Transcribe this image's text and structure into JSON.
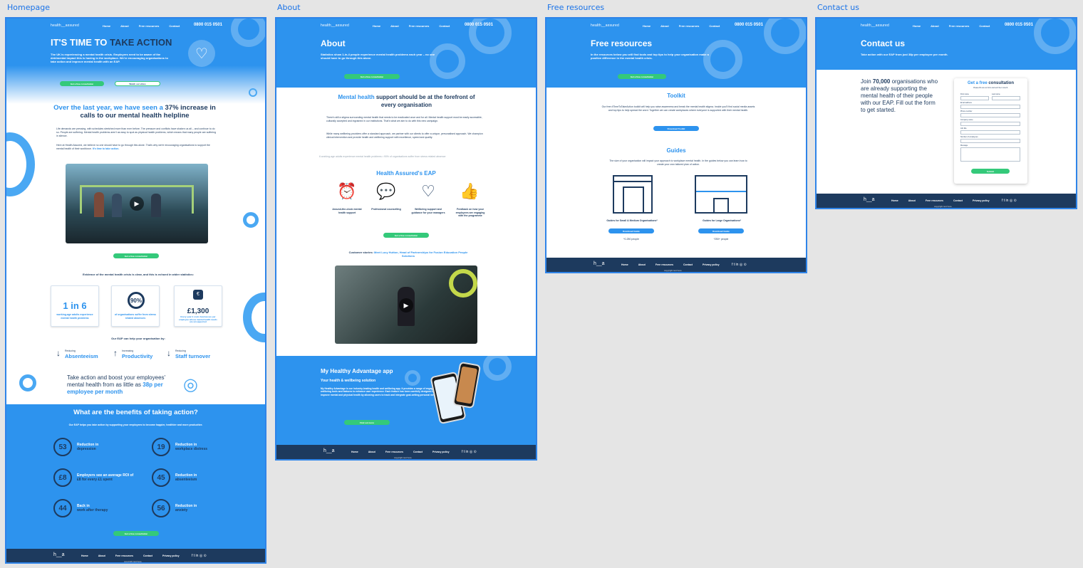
{
  "labels": {
    "homepage": "Homepage",
    "about": "About",
    "resources": "Free resources",
    "contact": "Contact us"
  },
  "nav": {
    "logo": "health__assured",
    "links": [
      "Home",
      "About",
      "Free resources",
      "Contact"
    ],
    "phone": "0800 015 0501"
  },
  "home": {
    "hero_title_a": "IT'S TIME TO ",
    "hero_title_b": "TAKE ACTION",
    "hero_text": "The UK is experiencing a mental health crisis. Employers need to be aware of the detrimental impact this is having in the workplace. We're encouraging organisations to take action and improve mental health with an EAP.",
    "btn_consult": "Get a free consultation",
    "btn_video": "Watch our video",
    "stat_heading_a": "Over the last year, we have seen a ",
    "stat_heading_b": "37% increase",
    "stat_heading_c": " in calls to our mental health helpline",
    "para1": "Life demands are pressing, with schedules stretched more than ever before. The pressure and conflicts have shaken us all – and continue to do so. People are suffering. Mental health problems aren't as easy to spot as physical health problems, which means that many people are suffering in silence.",
    "para2": "Here at Health Assured, we believe no one should have to go through this alone. That's why we're encouraging organisations to support the mental health of their workforce.",
    "para2_link": "It's time to take action.",
    "evidence": "Evidence of the mental health crisis is clear, and this is echoed in wider statistics:",
    "stats": [
      {
        "big": "1 in 6",
        "label": "working-age adults experience mental health problems"
      },
      {
        "big": "90%",
        "label": "of organisations suffer from stress related absences"
      },
      {
        "big": "£1,300",
        "label": "Every year it costs businesses per employee whose mental health needs are unsupported"
      }
    ],
    "eap_help": "Our EAP can help your organisation by:",
    "helps": [
      {
        "small": "Reducing",
        "big": "Absenteeism",
        "arrow": "↓"
      },
      {
        "small": "Increasing",
        "big": "Productivity",
        "arrow": "↑"
      },
      {
        "small": "Reducing",
        "big": "Staff turnover",
        "arrow": "↓"
      }
    ],
    "boost_a": "Take action and boost your employees' mental health from as little as ",
    "boost_b": "38p per employee per month",
    "benefits_title": "What are the benefits of taking action?",
    "benefits_sub": "Our EAP helps you take action by supporting your employees to become happier, healthier and more productive.",
    "benefits": [
      {
        "num": "53",
        "a": "Reduction in",
        "b": "depression"
      },
      {
        "num": "19",
        "a": "Reduction in",
        "b": "workplace distress"
      },
      {
        "num": "£8",
        "a": "Employers see an average ROI of",
        "b": "£8 for every £1 spent"
      },
      {
        "num": "45",
        "a": "Reduction in",
        "b": "absenteeism"
      },
      {
        "num": "44",
        "a": "Back in",
        "b": "work after therapy"
      },
      {
        "num": "56",
        "a": "Reduction in",
        "b": "anxiety"
      }
    ]
  },
  "about": {
    "title": "About",
    "intro": "Statistics show 1-in-4 people experience mental health problems each year – no one should have to go through this alone.",
    "btn": "Get a free consultation",
    "h2_a": "Mental health",
    "h2_b": " support should be at the forefront of every organisation",
    "p1": "There's still a stigma surrounding mental health that needs to be eradicated once and for all. Mental health support must be easily accessible, culturally accepted and ingrained in our institutions. That's what we aim to do with this new campaign.",
    "p2": "While many wellbeing providers offer a standard approach, we partner with our clients to offer a unique, personalised approach. We champion clinical intervention and provide health and wellbeing support with excellence, speed and quality.",
    "ticker": "6 working-age adults experience mental health problems • 90% of organisations suffer from stress related absence",
    "eap_title": "Health Assured's EAP",
    "eap_items": [
      {
        "icon": "⏰",
        "label": "Around-the-clock mental health support"
      },
      {
        "icon": "💬",
        "label": "Professional counselling"
      },
      {
        "icon": "♡",
        "label": "Wellbeing support and guidance for your managers"
      },
      {
        "icon": "👍",
        "label": "Feedback on how your employees are engaging with the programme"
      }
    ],
    "story_a": "Customer stories: ",
    "story_b": "Meet Lucy Hutton, Head of Partnerships for Fusion Education People Solutions",
    "app_title": "My Healthy Advantage app",
    "app_sub": "Your health & wellbeing solution",
    "app_text": "My Healthy Advantage is our industry-leading health and wellbeing app. It provides a range of engaging wellbeing tools and features to enhance user experience. Each feature has been carefully designed to improve mental and physical health by allowing users to track and integrate goal-setting personal metrics.",
    "app_btn": "Find out more"
  },
  "resources": {
    "title": "Free resources",
    "intro": "In the resources below you will find tools and top tips to help your organisation make a positive difference in the mental health crisis.",
    "btn": "Get a free consultation",
    "toolkit": "Toolkit",
    "toolkit_text": "Our free #TimeToTakeAction toolkit will help you raise awareness and break the mental health stigma. Inside you'll find social media assets and top tips to help spread the word. Together we can create workplaces where everyone is supported with their mental health.",
    "toolkit_btn": "Download Toolkit",
    "guides": "Guides",
    "guides_text": "The size of your organisation will impact your approach to workplace mental health. In the guides below you can learn how to create your own tailored plan of action.",
    "guide_small": "Guides for Small & Medium Organisations*",
    "guide_large": "Guides for Large Organisations*",
    "guide_btn": "Download Guide",
    "small_note": "*0-250 people",
    "large_note": "*250+ people"
  },
  "contact": {
    "title": "Contact us",
    "intro": "Take action with our EAP from just 38p per employee per month.",
    "join_a": "Join ",
    "join_b": "70,000",
    "join_c": " organisations who are already supporting the mental health of their people with our EAP. Fill out the form to get started.",
    "form_title_a": "Get a ",
    "form_title_b": "free",
    "form_title_c": " consultation",
    "form_sub": "Please fill out our form and we'll be in touch.",
    "fields": [
      "First name",
      "Last name",
      "Email address",
      "Phone number",
      "Company name",
      "Job title",
      "Number of employees",
      "Message"
    ],
    "submit": "Submit"
  },
  "footer": {
    "logo": "h__a",
    "links": [
      "Home",
      "About",
      "Free resources",
      "Contact",
      "Privacy policy"
    ],
    "social": "f  t  in  ◎  ⊙",
    "copy": "copyright text here"
  }
}
